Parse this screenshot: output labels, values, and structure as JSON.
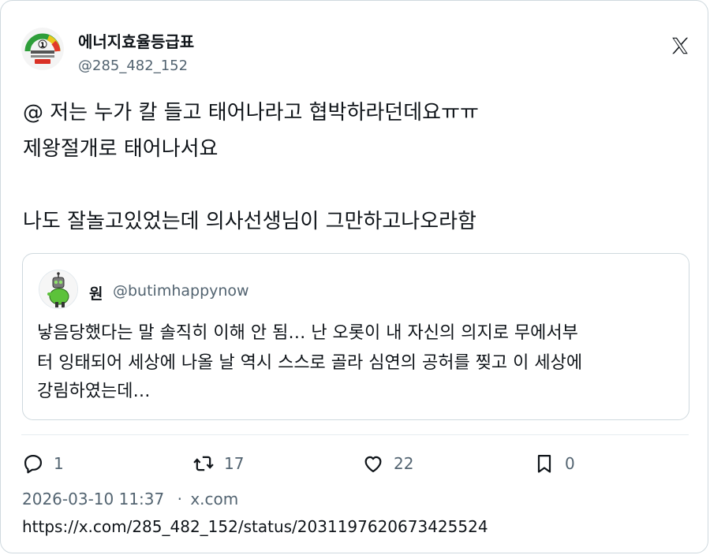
{
  "account": {
    "name": "에너지효율등급표",
    "handle": "@285_482_152",
    "avatar_icon": "energy-efficiency-grade-label",
    "avatar_text": "1"
  },
  "platform_icon": "x-logo-icon",
  "post": {
    "lines": [
      "@ 저는 누가 칼 들고 태어나라고 협박하라던데요ㅠㅠ",
      "제왕절개로 태어나서요",
      "나도 잘놀고있었는데 의사선생님이 그만하고나오라함"
    ]
  },
  "quote": {
    "name": "원",
    "handle": "@butimhappynow",
    "avatar_icon": "green-robot-cartoon-avatar",
    "lines": [
      "낳음당했다는 말 솔직히 이해 안 됨… 난 오롯이 내 자신의 의지로 무에서부",
      "터 잉태되어 세상에 나올 날 역시 스스로 골라 심연의 공허를 찢고 이 세상에",
      "강림하였는데…"
    ]
  },
  "actions": {
    "replies": "1",
    "reposts": "17",
    "likes": "22",
    "bookmarks": "0"
  },
  "meta": {
    "timestamp": "2026-03-10 11:37",
    "separator": "·",
    "source": "x.com"
  },
  "url": "https://x.com/285_482_152/status/2031197620673425524",
  "colors": {
    "text": "#0f1419",
    "secondary": "#536471",
    "border": "#cfd9de"
  }
}
